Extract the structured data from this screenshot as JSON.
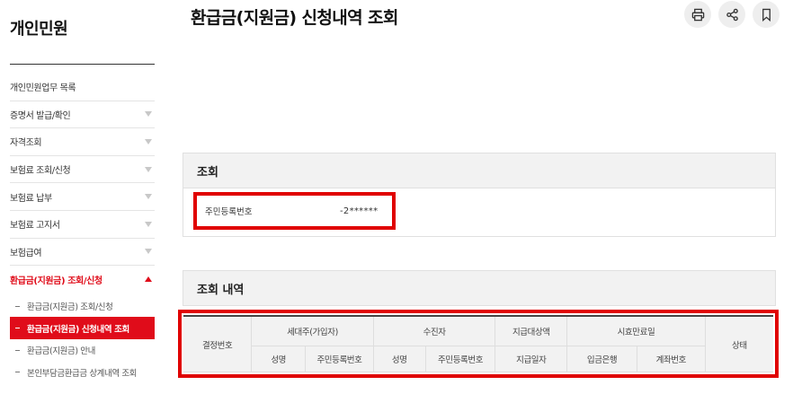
{
  "sidebar": {
    "title": "개인민원",
    "items": [
      {
        "label": "개인민원업무 목록",
        "arrow": false
      },
      {
        "label": "증명서 발급/확인",
        "arrow": true
      },
      {
        "label": "자격조회",
        "arrow": true
      },
      {
        "label": "보험료 조회/신청",
        "arrow": true
      },
      {
        "label": "보험료 납부",
        "arrow": true
      },
      {
        "label": "보험료 고지서",
        "arrow": true
      },
      {
        "label": "보험급여",
        "arrow": true
      },
      {
        "label": "환급금(지원금) 조회/신청",
        "arrow": true,
        "active": true
      }
    ],
    "subitems": [
      {
        "label": "환급금(지원금) 조회/신청"
      },
      {
        "label": "환급금(지원금) 신청내역 조회",
        "current": true
      },
      {
        "label": "환급금(지원금) 안내"
      },
      {
        "label": "본인부담금환급금 상계내역 조회"
      }
    ]
  },
  "header": {
    "title": "환급금(지원금) 신청내역 조회",
    "tools": [
      "print-icon",
      "share-icon",
      "bookmark-icon"
    ]
  },
  "search": {
    "heading": "조회",
    "id_label": "주민등록번호",
    "id_value": "-2******"
  },
  "results": {
    "heading": "조회 내역",
    "columns_top": [
      "결정번호",
      "세대주(가입자)",
      "수진자",
      "지급대상액",
      "시효만료일",
      "상태"
    ],
    "columns_bottom": [
      "성명",
      "주민등록번호",
      "성명",
      "주민등록번호",
      "지급일자",
      "입금은행",
      "계좌번호"
    ]
  },
  "colors": {
    "accent": "#e00c1a",
    "highlight_box": "#e00000"
  }
}
